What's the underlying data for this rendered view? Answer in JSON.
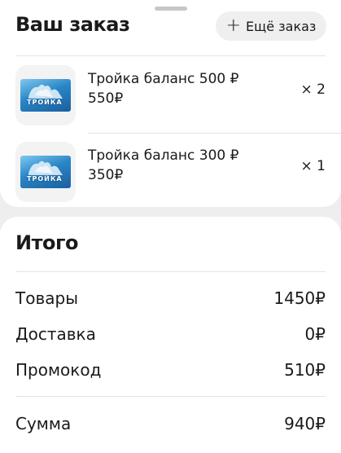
{
  "order": {
    "title": "Ваш заказ",
    "more_button": "Ещё заказ",
    "items": [
      {
        "name": "Тройка баланс 500 ₽",
        "price": "550₽",
        "qty": "× 2",
        "card_label": "ТРОЙКА"
      },
      {
        "name": "Тройка баланс 300 ₽",
        "price": "350₽",
        "qty": "× 1",
        "card_label": "ТРОЙКА"
      }
    ]
  },
  "summary": {
    "title": "Итого",
    "rows": [
      {
        "label": "Товары",
        "value": "1450₽"
      },
      {
        "label": "Доставка",
        "value": "0₽"
      },
      {
        "label": "Промокод",
        "value": "510₽"
      }
    ],
    "total": {
      "label": "Сумма",
      "value": "940₽"
    }
  },
  "icons": {
    "add": "plus-icon",
    "card": "troika-card-icon"
  }
}
